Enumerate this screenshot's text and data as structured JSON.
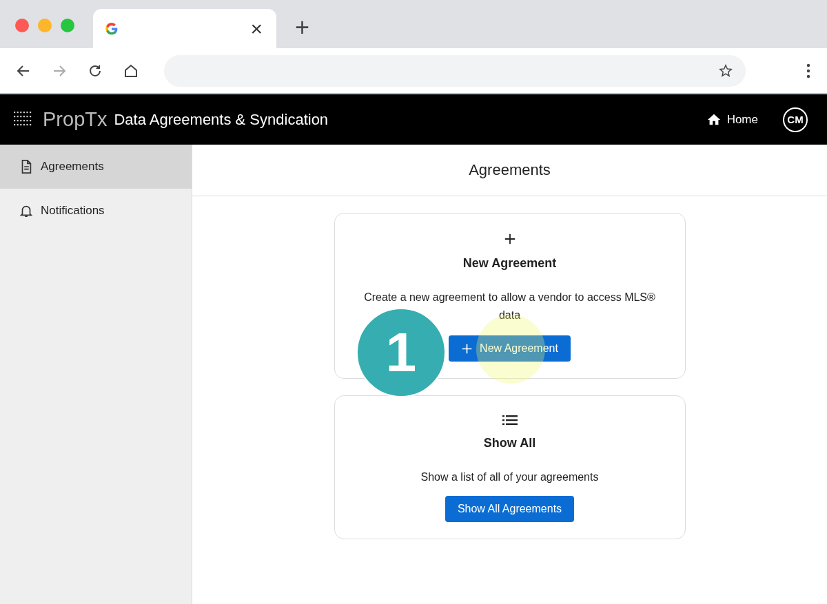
{
  "browser": {
    "tab_close": "×",
    "new_tab": "+"
  },
  "header": {
    "logo": "PropTx",
    "title": "Data Agreements & Syndication",
    "home": "Home",
    "avatar": "CM"
  },
  "sidebar": {
    "items": [
      {
        "label": "Agreements",
        "selected": true
      },
      {
        "label": "Notifications",
        "selected": false
      }
    ]
  },
  "page_title": "Agreements",
  "cards": [
    {
      "title": "New Agreement",
      "text": "Create a new agreement to allow a vendor to access MLS® data",
      "button": "New Agreement",
      "button_icon": true
    },
    {
      "title": "Show All",
      "text": "Show a list of all of your agreements",
      "button": "Show All Agreements",
      "button_icon": false
    }
  ],
  "step_badge": "1"
}
